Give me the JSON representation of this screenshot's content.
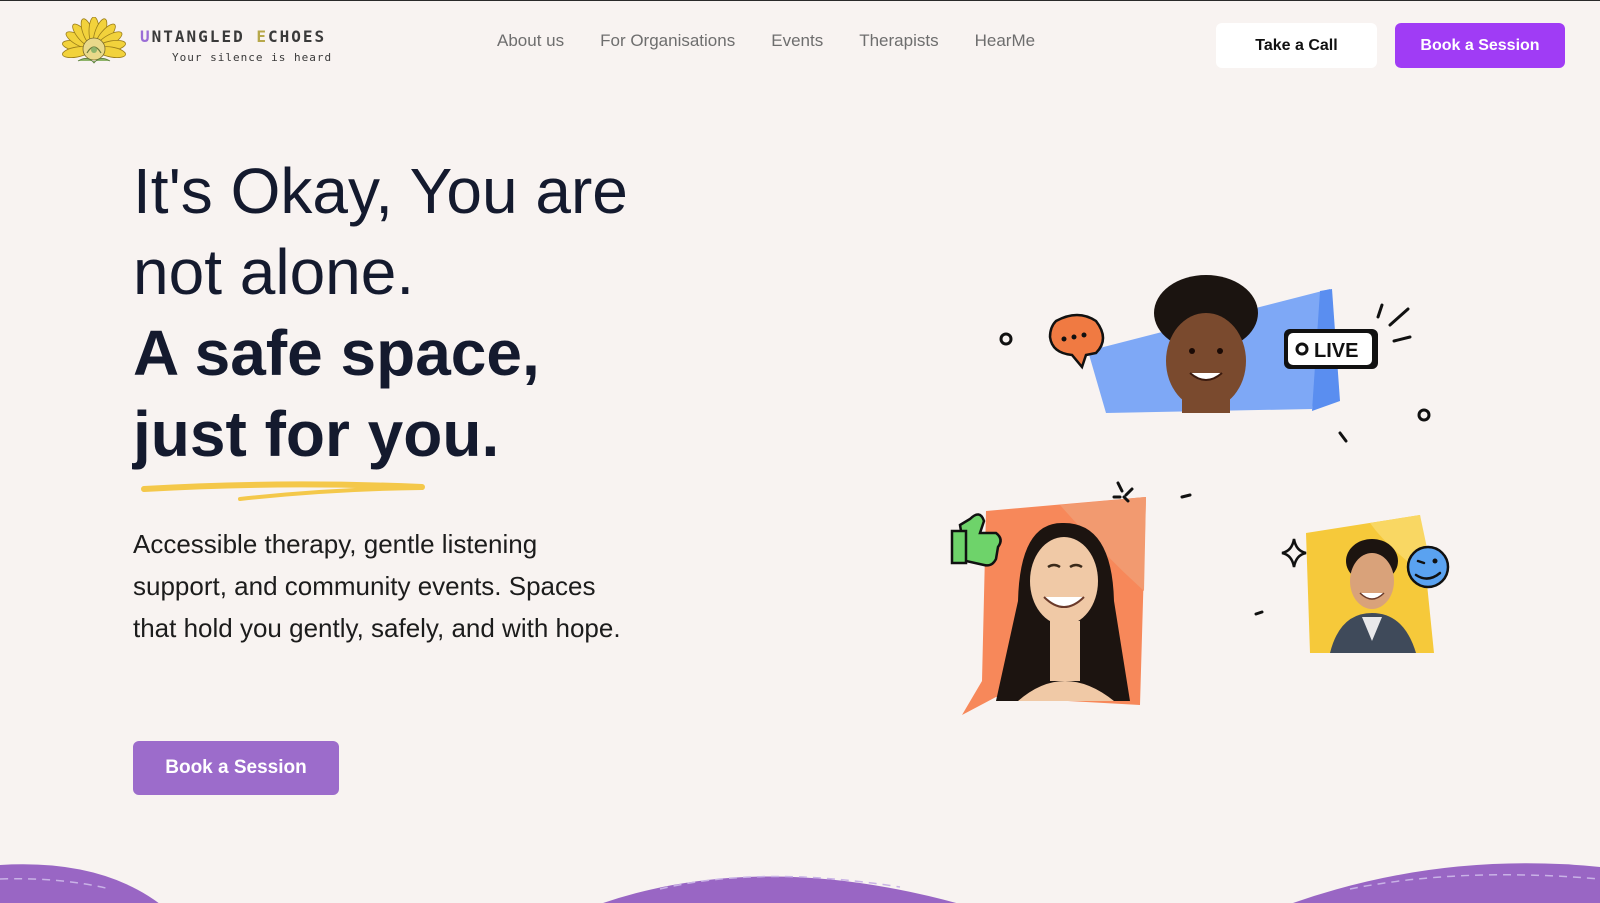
{
  "brand": {
    "title_first_letter": "U",
    "title_part1": "NTANGLED ",
    "title_second_letter": "E",
    "title_part2": "CHOES",
    "tagline": "Your silence is heard"
  },
  "nav": {
    "items": [
      {
        "label": "About us"
      },
      {
        "label": "For Organisations"
      },
      {
        "label": "Events"
      },
      {
        "label": "Therapists"
      },
      {
        "label": "HearMe"
      }
    ],
    "call_label": "Take a Call",
    "book_label": "Book a Session"
  },
  "hero": {
    "line1": "It's Okay, You are",
    "line2": "not alone.",
    "line3": "A safe space,",
    "line4": "just for you.",
    "description": "Accessible therapy, gentle listening support, and community events. Spaces that hold you gently, safely, and with hope.",
    "cta_label": "Book a Session"
  },
  "illustration": {
    "live_badge": "LIVE"
  },
  "colors": {
    "background": "#f8f3f1",
    "primary_purple": "#a03cf5",
    "cta_purple": "#9c6ccb",
    "wave_purple": "#9966c4",
    "underline_yellow": "#f4c84a"
  }
}
